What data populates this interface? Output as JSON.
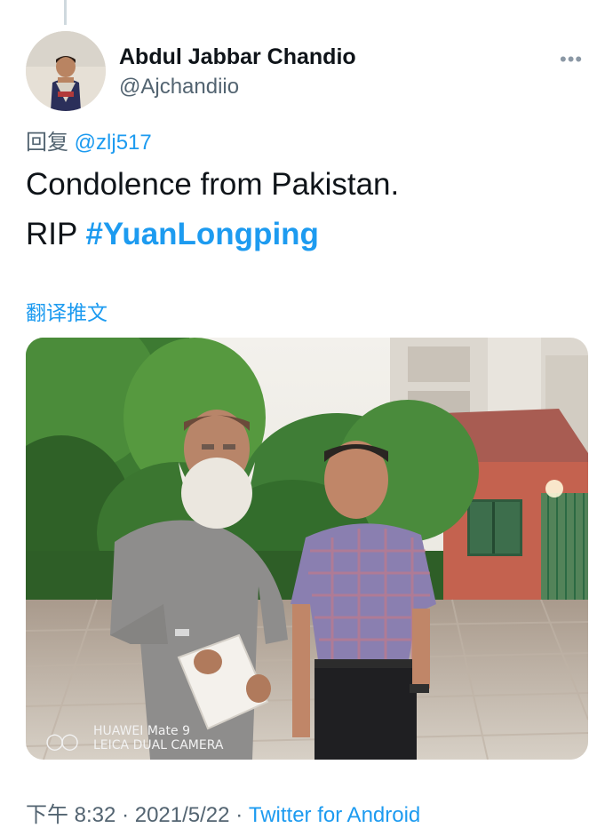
{
  "tweet": {
    "author": {
      "display_name": "Abdul Jabbar Chandio",
      "handle": "@Ajchandiio"
    },
    "reply_prefix": "回复",
    "reply_to": "@zlj517",
    "text_line1": "Condolence from Pakistan.",
    "text_line2_prefix": "RIP ",
    "hashtag": "#YuanLongping",
    "translate_label": "翻译推文",
    "photo": {
      "watermark_model": "HUAWEI Mate 9",
      "watermark_camera": "LEICA DUAL CAMERA"
    },
    "time": "下午 8:32",
    "separator": "·",
    "date": "2021/5/22",
    "source": "Twitter for Android"
  },
  "icons": {
    "more": "more-options-icon",
    "watermark": "leica-lens-icon"
  },
  "colors": {
    "link": "#1d9bf0",
    "secondary_text": "#536471",
    "primary_text": "#0f1419"
  }
}
